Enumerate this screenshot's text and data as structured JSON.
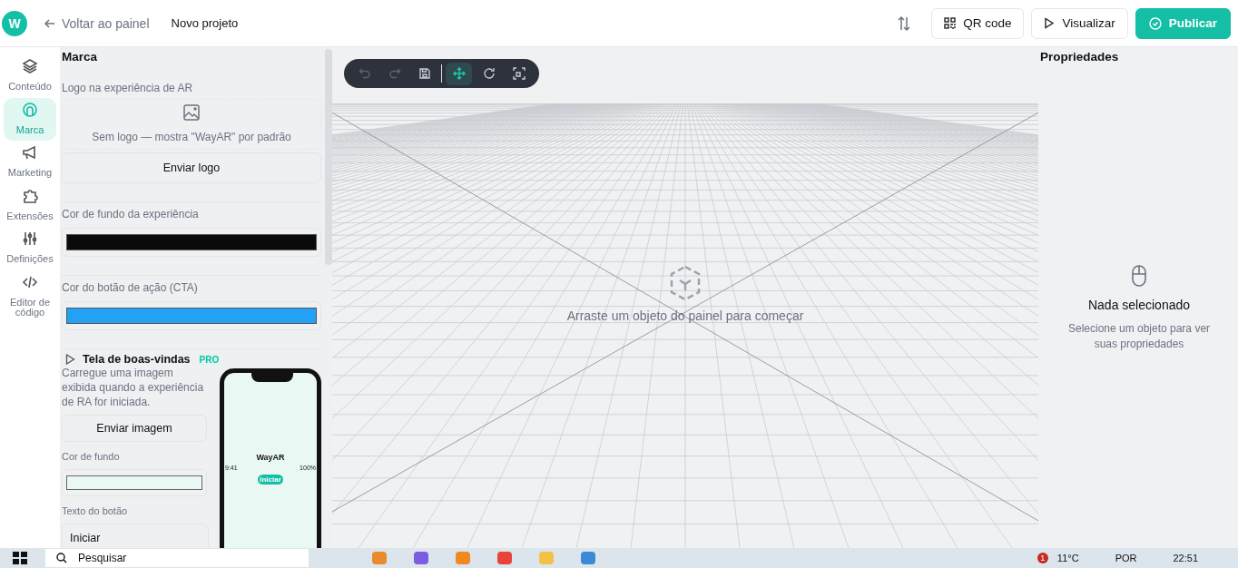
{
  "topbar": {
    "logo": "W",
    "back": "Voltar ao painel",
    "project": "Novo projeto",
    "buttons": [
      {
        "kind": "qr",
        "label": "QR code"
      },
      {
        "kind": "play",
        "label": "Visualizar"
      },
      {
        "kind": "publish",
        "label": "Publicar"
      }
    ]
  },
  "nav": [
    {
      "label": "Conteúdo",
      "selected": false
    },
    {
      "label": "Marca",
      "selected": true
    },
    {
      "label": "Marketing",
      "selected": false
    },
    {
      "label": "Extensões",
      "selected": false
    },
    {
      "label": "Definições",
      "selected": false
    },
    {
      "label": "Editor de código",
      "selected": false
    }
  ],
  "panel": {
    "title": "Marca",
    "logo_label": "Logo na experiência de AR",
    "logo_empty": "Sem logo — mostra \"WayAR\" por padrão",
    "upload_logo": "Enviar logo",
    "colors": [
      {
        "label": "Cor de fundo da experiência",
        "color": "#0a0a0a"
      },
      {
        "label": "Cor do botão de ação (CTA)",
        "color": "#22a1f5"
      }
    ],
    "welcome": {
      "title": "Tela de boas-vindas",
      "badge": "PRO",
      "description": "Carregue uma imagem exibida quando a experiência de RA for iniciada.",
      "upload": "Enviar imagem",
      "bg_field": {
        "label": "Cor de fundo",
        "color": "#eaf8f4"
      },
      "button_label": "Texto do botão",
      "button_value": "Iniciar",
      "phone": {
        "time": "9:41",
        "battery": "100%",
        "brand": "WayAR",
        "cta": "Iniciar"
      }
    }
  },
  "toolbar": [
    {
      "disabled": true,
      "selected": false
    },
    {
      "disabled": true,
      "selected": false
    },
    {
      "disabled": false,
      "selected": false
    },
    {
      "disabled": false,
      "selected": true
    },
    {
      "disabled": false,
      "selected": false
    },
    {
      "disabled": false,
      "selected": false
    }
  ],
  "canvas": {
    "hint": "Arraste um objeto do painel para começar"
  },
  "properties": {
    "title": "Propriedades",
    "empty_title": "Nada selecionado",
    "empty_text": "Selecione um objeto para ver suas propriedades"
  },
  "taskbar": {
    "search": "Pesquisar",
    "temperature": "11°C",
    "language": "POR",
    "time": "22:51",
    "notifications": "1"
  }
}
